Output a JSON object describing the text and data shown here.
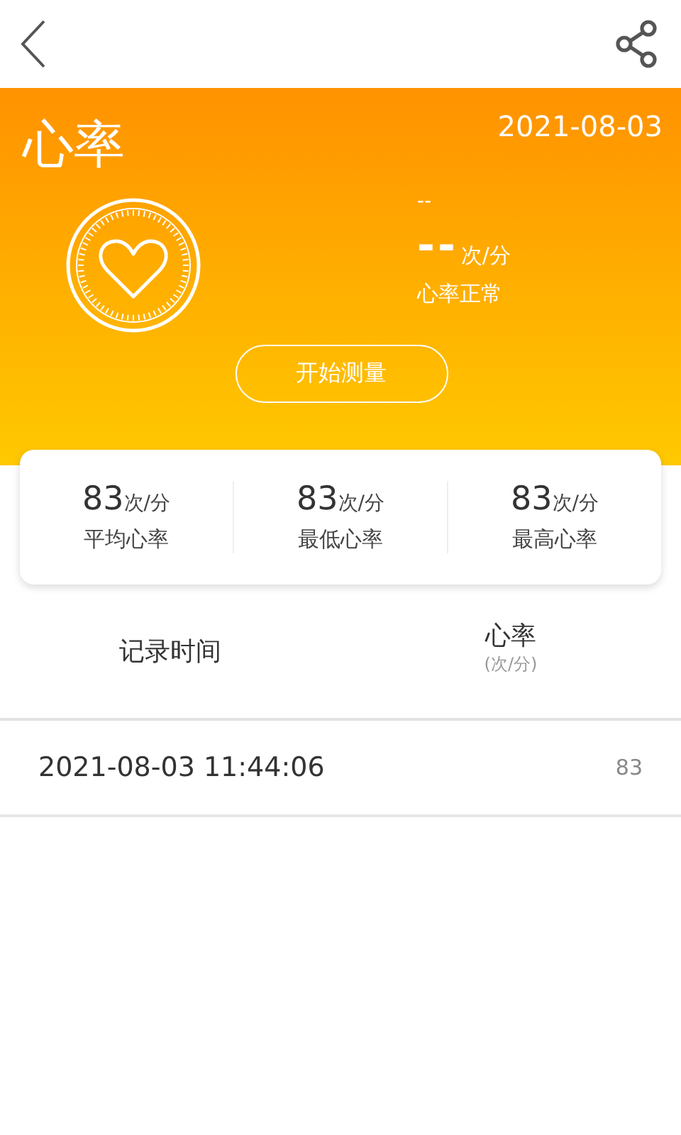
{
  "title": "心率",
  "date": "2021-08-03",
  "current": {
    "small": "--",
    "value": "--",
    "unit": "次/分",
    "status": "心率正常"
  },
  "start_button": "开始测量",
  "stats": [
    {
      "value": "83",
      "unit": "次/分",
      "label": "平均心率"
    },
    {
      "value": "83",
      "unit": "次/分",
      "label": "最低心率"
    },
    {
      "value": "83",
      "unit": "次/分",
      "label": "最高心率"
    }
  ],
  "table": {
    "columns": [
      {
        "label": "记录时间"
      },
      {
        "label": "心率",
        "sub": "(次/分)"
      }
    ],
    "rows": [
      {
        "time": "2021-08-03 11:44:06",
        "rate": "83"
      }
    ]
  }
}
